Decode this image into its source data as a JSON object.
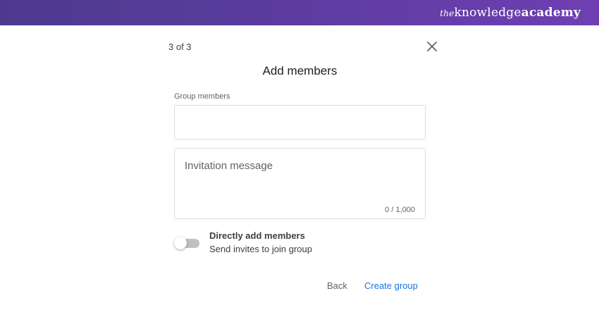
{
  "brand": {
    "the": "the",
    "knowledge": "knowledge",
    "academy": "academy"
  },
  "dialog": {
    "step": "3 of 3",
    "title": "Add members",
    "close_icon": "close-icon"
  },
  "members_field": {
    "label": "Group members",
    "value": ""
  },
  "invitation_field": {
    "placeholder": "Invitation message",
    "value": "",
    "counter": "0 / 1,000"
  },
  "direct_add": {
    "title": "Directly add members",
    "subtitle": "Send invites to join group",
    "enabled": false
  },
  "actions": {
    "back_label": "Back",
    "create_label": "Create group"
  },
  "colors": {
    "brand_bar": "#5b3c9e",
    "primary_action": "#1a73e8",
    "toggle_track_off": "#bdc1c6"
  }
}
